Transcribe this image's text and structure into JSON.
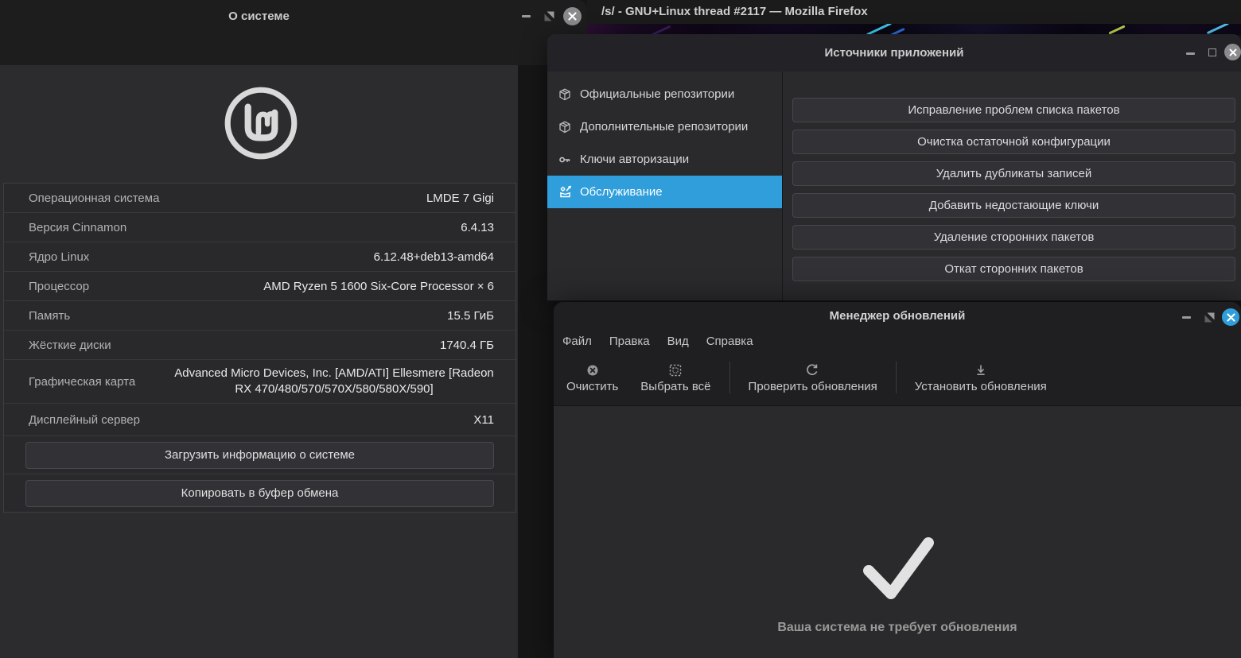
{
  "about_window": {
    "title": "О системе",
    "rows": [
      {
        "label": "Операционная система",
        "value": "LMDE 7 Gigi"
      },
      {
        "label": "Версия Cinnamon",
        "value": "6.4.13"
      },
      {
        "label": "Ядро Linux",
        "value": "6.12.48+deb13-amd64"
      },
      {
        "label": "Процессор",
        "value": "AMD Ryzen 5 1600 Six-Core Processor × 6"
      },
      {
        "label": "Память",
        "value": "15.5 ГиБ"
      },
      {
        "label": "Жёсткие диски",
        "value": "1740.4 ГБ"
      },
      {
        "label": "Графическая карта",
        "value": "Advanced Micro Devices, Inc. [AMD/ATI] Ellesmere [Radeon RX 470/480/570/570X/580/580X/590]"
      },
      {
        "label": "Дисплейный сервер",
        "value": "X11"
      }
    ],
    "buttons": [
      {
        "label": "Загрузить информацию о системе"
      },
      {
        "label": "Копировать в буфер обмена"
      }
    ]
  },
  "firefox": {
    "title": "/s/ - GNU+Linux thread #2117 — Mozilla Firefox"
  },
  "sources_window": {
    "title": "Источники приложений",
    "sidebar": [
      {
        "icon": "package-icon",
        "label": "Официальные репозитории",
        "selected": false
      },
      {
        "icon": "package-icon",
        "label": "Дополнительные репозитории",
        "selected": false
      },
      {
        "icon": "key-icon",
        "label": "Ключи авторизации",
        "selected": false
      },
      {
        "icon": "maintenance-icon",
        "label": "Обслуживание",
        "selected": true
      }
    ],
    "maintenance_buttons": [
      {
        "label": "Исправление проблем списка пакетов"
      },
      {
        "label": "Очистка остаточной конфигурации"
      },
      {
        "label": "Удалить дубликаты записей"
      },
      {
        "label": "Добавить недостающие ключи"
      },
      {
        "label": "Удаление сторонних пакетов"
      },
      {
        "label": "Откат сторонних пакетов"
      }
    ]
  },
  "update_manager": {
    "title": "Менеджер обновлений",
    "menu": [
      {
        "label": "Файл"
      },
      {
        "label": "Правка"
      },
      {
        "label": "Вид"
      },
      {
        "label": "Справка"
      }
    ],
    "toolbar": [
      {
        "icon": "clear-icon",
        "label": "Очистить"
      },
      {
        "icon": "select-all-icon",
        "label": "Выбрать всё"
      },
      {
        "icon": "refresh-icon",
        "label": "Проверить обновления"
      },
      {
        "icon": "install-icon",
        "label": "Установить обновления"
      }
    ],
    "status": "Ваша система не требует обновления"
  },
  "colors": {
    "accent_blue": "#2f9edb",
    "titlebar": "#1d1d1d",
    "window_bg": "#2c2c2e",
    "checkmark": "#e2e2e2",
    "status_text": "#999999"
  }
}
